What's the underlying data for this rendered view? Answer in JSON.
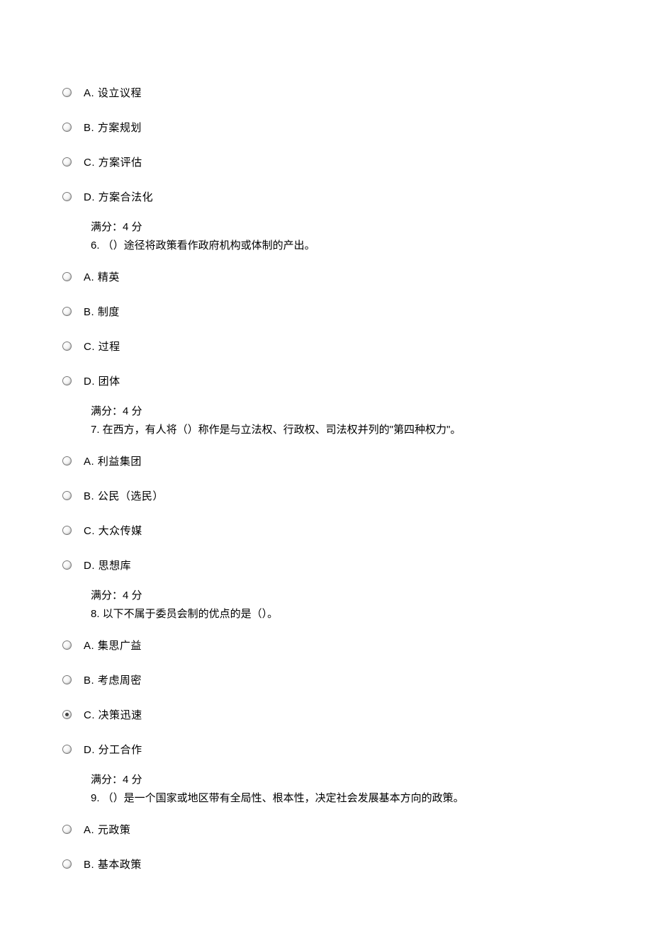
{
  "groups": [
    {
      "options": [
        {
          "letter": "A.",
          "text": "设立议程",
          "selected": false
        },
        {
          "letter": "B.",
          "text": "方案规划",
          "selected": false
        },
        {
          "letter": "C.",
          "text": "方案评估",
          "selected": false
        },
        {
          "letter": "D.",
          "text": "方案合法化",
          "selected": false
        }
      ],
      "score": "满分：4 分",
      "next_q_num": "6.",
      "next_q_text": "（）途径将政策看作政府机构或体制的产出。"
    },
    {
      "options": [
        {
          "letter": "A.",
          "text": "精英",
          "selected": false
        },
        {
          "letter": "B.",
          "text": "制度",
          "selected": false
        },
        {
          "letter": "C.",
          "text": "过程",
          "selected": false
        },
        {
          "letter": "D.",
          "text": "团体",
          "selected": false
        }
      ],
      "score": "满分：4 分",
      "next_q_num": "7.",
      "next_q_text": "在西方，有人将（）称作是与立法权、行政权、司法权并列的\"第四种权力\"。"
    },
    {
      "options": [
        {
          "letter": "A.",
          "text": "利益集团",
          "selected": false
        },
        {
          "letter": "B.",
          "text": "公民（选民）",
          "selected": false
        },
        {
          "letter": "C.",
          "text": "大众传媒",
          "selected": false
        },
        {
          "letter": "D.",
          "text": "思想库",
          "selected": false
        }
      ],
      "score": "满分：4 分",
      "next_q_num": "8.",
      "next_q_text": "以下不属于委员会制的优点的是（）。"
    },
    {
      "options": [
        {
          "letter": "A.",
          "text": "集思广益",
          "selected": false
        },
        {
          "letter": "B.",
          "text": "考虑周密",
          "selected": false
        },
        {
          "letter": "C.",
          "text": "决策迅速",
          "selected": true
        },
        {
          "letter": "D.",
          "text": "分工合作",
          "selected": false
        }
      ],
      "score": "满分：4 分",
      "next_q_num": "9.",
      "next_q_text": "（）是一个国家或地区带有全局性、根本性，决定社会发展基本方向的政策。"
    },
    {
      "options": [
        {
          "letter": "A.",
          "text": "元政策",
          "selected": false
        },
        {
          "letter": "B.",
          "text": "基本政策",
          "selected": false
        }
      ],
      "score": null,
      "next_q_num": null,
      "next_q_text": null
    }
  ]
}
